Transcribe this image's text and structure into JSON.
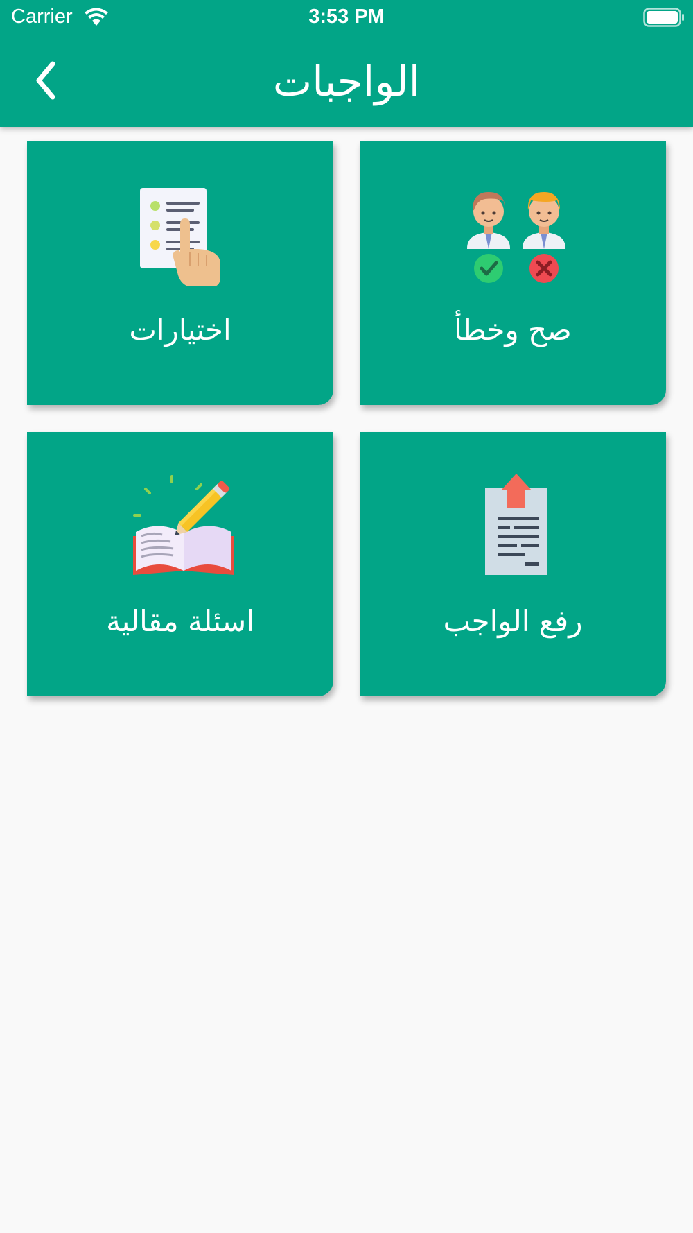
{
  "status_bar": {
    "carrier": "Carrier",
    "time": "3:53 PM"
  },
  "header": {
    "title": "الواجبات",
    "back_icon": "chevron-left-icon"
  },
  "cards": [
    {
      "label": "صح وخطأ",
      "icon": "true-false-icon"
    },
    {
      "label": "اختيارات",
      "icon": "multiple-choice-icon"
    },
    {
      "label": "رفع الواجب",
      "icon": "upload-document-icon"
    },
    {
      "label": "اسئلة مقالية",
      "icon": "essay-book-icon"
    }
  ],
  "colors": {
    "primary": "#02a587",
    "background": "#f9f9f9",
    "text_on_primary": "#ffffff"
  }
}
